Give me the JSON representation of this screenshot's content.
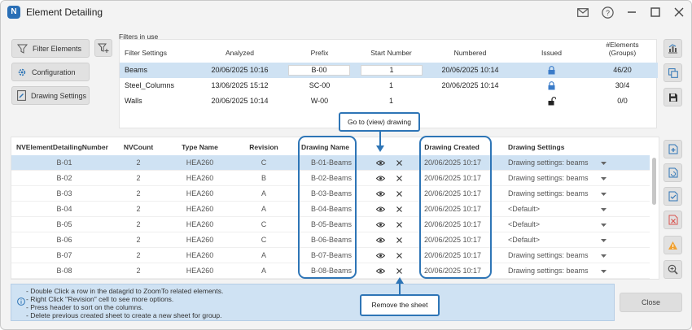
{
  "window": {
    "title": "Element Detailing",
    "logo_letter": "N",
    "controls": [
      "mail-icon",
      "help-icon",
      "minimize-icon",
      "maximize-icon",
      "close-icon"
    ]
  },
  "toolbar": {
    "filter_elements": "Filter Elements",
    "configuration": "Configuration",
    "drawing_settings": "Drawing Settings"
  },
  "filters": {
    "label": "Filters in use",
    "headers": {
      "filter_settings": "Filter Settings",
      "analyzed": "Analyzed",
      "prefix": "Prefix",
      "start_number": "Start Number",
      "numbered": "Numbered",
      "issued": "Issued",
      "elements_line1": "#Elements",
      "elements_line2": "(Groups)"
    },
    "rows": [
      {
        "name": "Beams",
        "analyzed": "20/06/2025 10:16",
        "prefix": "B-00",
        "start": "1",
        "numbered": "20/06/2025 10:14",
        "issued": "lock-icon",
        "elements": "46/20",
        "selected": true
      },
      {
        "name": "Steel_Columns",
        "analyzed": "13/06/2025 15:12",
        "prefix": "SC-00",
        "start": "1",
        "numbered": "20/06/2025 10:14",
        "issued": "lock-icon",
        "elements": "30/4",
        "selected": false
      },
      {
        "name": "Walls",
        "analyzed": "20/06/2025 10:14",
        "prefix": "W-00",
        "start": "1",
        "numbered": "",
        "issued": "unlock-icon",
        "elements": "0/0",
        "selected": false
      }
    ]
  },
  "grid": {
    "headers": {
      "number": "NVElementDetailingNumber",
      "count": "NVCount",
      "type": "Type Name",
      "revision": "Revision",
      "drawing_name": "Drawing Name",
      "drawing_created": "Drawing Created",
      "drawing_settings": "Drawing Settings"
    },
    "rows": [
      {
        "number": "B-01",
        "count": "2",
        "type": "HEA260",
        "revision": "C",
        "drawing": "B-01-Beams",
        "created": "20/06/2025 10:17",
        "settings": "Drawing settings: beams"
      },
      {
        "number": "B-02",
        "count": "2",
        "type": "HEA260",
        "revision": "B",
        "drawing": "B-02-Beams",
        "created": "20/06/2025 10:17",
        "settings": "Drawing settings: beams"
      },
      {
        "number": "B-03",
        "count": "2",
        "type": "HEA260",
        "revision": "A",
        "drawing": "B-03-Beams",
        "created": "20/06/2025 10:17",
        "settings": "Drawing settings: beams"
      },
      {
        "number": "B-04",
        "count": "2",
        "type": "HEA260",
        "revision": "A",
        "drawing": "B-04-Beams",
        "created": "20/06/2025 10:17",
        "settings": "<Default>"
      },
      {
        "number": "B-05",
        "count": "2",
        "type": "HEA260",
        "revision": "C",
        "drawing": "B-05-Beams",
        "created": "20/06/2025 10:17",
        "settings": "<Default>"
      },
      {
        "number": "B-06",
        "count": "2",
        "type": "HEA260",
        "revision": "C",
        "drawing": "B-06-Beams",
        "created": "20/06/2025 10:17",
        "settings": "<Default>"
      },
      {
        "number": "B-07",
        "count": "2",
        "type": "HEA260",
        "revision": "A",
        "drawing": "B-07-Beams",
        "created": "20/06/2025 10:17",
        "settings": "Drawing settings: beams"
      },
      {
        "number": "B-08",
        "count": "2",
        "type": "HEA260",
        "revision": "A",
        "drawing": "B-08-Beams",
        "created": "20/06/2025 10:17",
        "settings": "Drawing settings: beams"
      }
    ]
  },
  "info": {
    "lines": [
      "- Double Click a row in the datagrid to ZoomTo related elements.",
      "- Right Click \"Revision\" cell to see more options.",
      "- Press header to sort on the columns.",
      "- Delete previous created sheet to create a new sheet for group."
    ]
  },
  "footer": {
    "close": "Close"
  },
  "annotations": {
    "goto": "Go to (view) drawing",
    "remove": "Remove the sheet"
  },
  "colors": {
    "accent": "#2e75b6",
    "selected_row": "#cfe2f3",
    "lock": "#3a7bc8",
    "warning": "#f0a030",
    "danger": "#d9534f"
  }
}
